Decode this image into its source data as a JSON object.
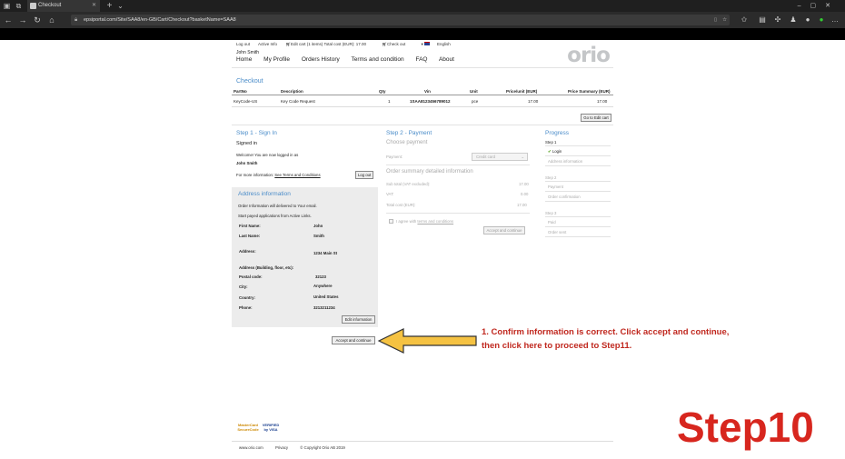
{
  "browser": {
    "tab_title": "Checkout",
    "url": "epsiportal.com/Site/SAA8/en-GB/Cart/Checkout?basketName=SAA8",
    "new_tab_symbol": "+"
  },
  "header": {
    "links": [
      "Log out",
      "Active Info",
      "Edit cart (1 items) Total cost (EUR): 17.00",
      "Check out",
      "English"
    ],
    "user": "John Smith",
    "nav": [
      "Home",
      "My Profile",
      "Orders History",
      "Terms and condition",
      "FAQ",
      "About"
    ],
    "logo": "orio"
  },
  "checkout": {
    "title": "Checkout",
    "columns": [
      "PartNo",
      "Description",
      "Qty",
      "Vin",
      "Unit",
      "Price/unit (EUR)",
      "Price Summary (EUR)"
    ],
    "row": [
      "KeyCode-US",
      "Key Code Request",
      "1",
      "1SAA8123456789012",
      "pce",
      "17.00",
      "17.00"
    ],
    "edit_cart_button": "Go to Edit cart"
  },
  "step1": {
    "title": "Step 1 - Sign In",
    "signed_in": "Signed in",
    "welcome": "Welcome! You are now logged in as",
    "user": "John Smith",
    "more_info": "For more information:",
    "terms_link": "See Terms and Conditions",
    "logout_button": "Log out"
  },
  "address": {
    "title": "Address information",
    "line1": "Order Information will delivered to Your email.",
    "line2": "Start payed applications from Active Links.",
    "first_name_label": "First Name:",
    "first_name": "John",
    "last_name_label": "Last Name:",
    "last_name": "Smith",
    "address_label": "Address:",
    "address": "1234 Main St",
    "address_extra_label": "Address (Building, floor, etc):",
    "postal_label": "Postal code:",
    "postal": "32123",
    "city_label": "City:",
    "city": "Anywhere",
    "country_label": "Country:",
    "country": "United States",
    "phone_label": "Phone:",
    "phone": "3213211234",
    "edit_button": "Edit information",
    "accept_button": "Accept and continue"
  },
  "step2": {
    "title": "Step 2 - Payment",
    "choose": "Choose payment",
    "payment_label": "Payment:",
    "payment_value": "Credit card",
    "summary_title": "Order summary detailed information",
    "subtotal_label": "Sub total (VAT excluded):",
    "subtotal": "17.00",
    "vat_label": "VAT:",
    "vat": "0.00",
    "total_label": "Total cost (EUR):",
    "total": "17.00",
    "agree_text": "I agree with",
    "agree_link": "terms and conditions",
    "accept_button": "Accept and continue"
  },
  "progress": {
    "title": "Progress",
    "step1": "Step 1",
    "login": "Login",
    "address_info": "Address information",
    "step2": "Step 2",
    "payment": "Payment",
    "order_confirmation": "Order confirmation",
    "step3": "Step 3",
    "paid": "Paid",
    "order_sent": "Order sent"
  },
  "footer": {
    "links": [
      "www.orio.com",
      "Privacy",
      "© Copyright Orio AB 2019"
    ],
    "mastercard": "MasterCard SecureCode",
    "visa": "VERIFIED by VISA"
  },
  "annotation": {
    "note": "1. Confirm information is correct. Click accept and continue, then click here to proceed to Step11.",
    "step": "Step10",
    "arrow_color": "#f5c242"
  }
}
